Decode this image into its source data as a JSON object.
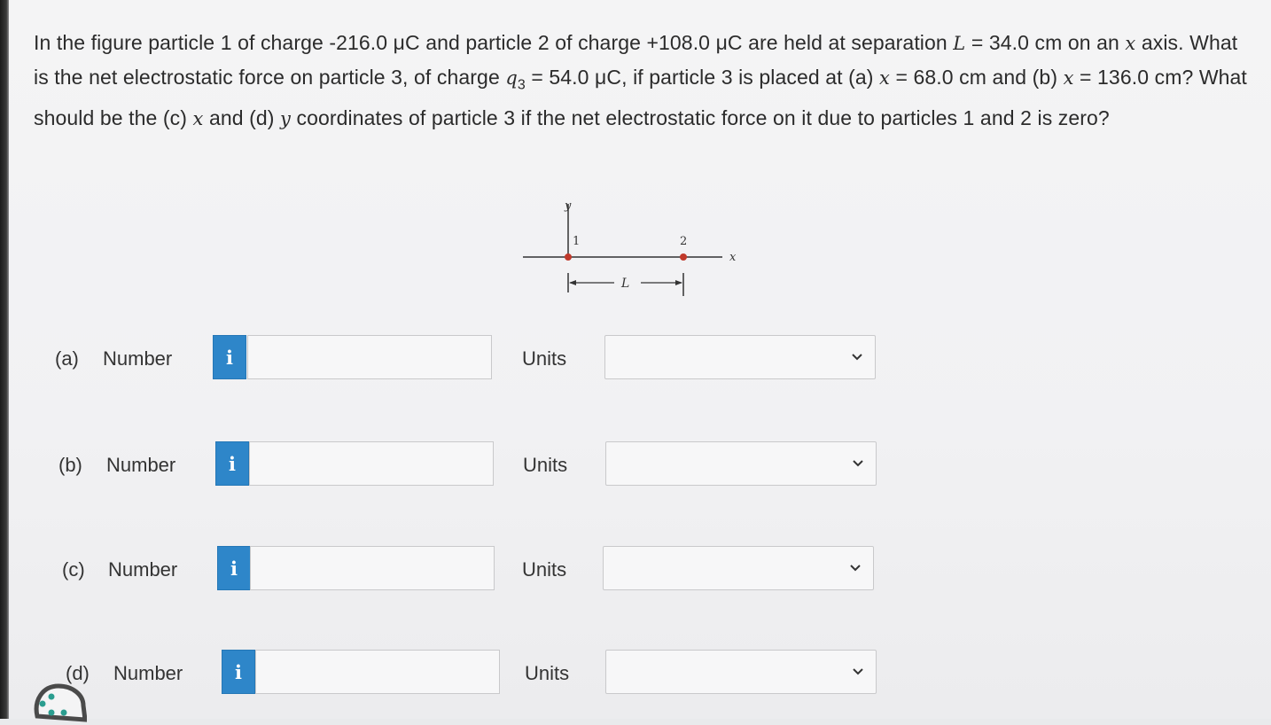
{
  "question": {
    "s1": "In the figure particle 1 of charge -216.0 μC and particle 2 of charge +108.0 μC are held at separation ",
    "L": "L",
    "s2": " = 34.0 cm on an ",
    "x1": "x",
    "s3": " axis. What is the net electrostatic force on particle 3, of charge ",
    "q3": "q",
    "q3sub": "3",
    "s4": " = 54.0 μC, if particle 3 is placed at (a) ",
    "x2": "x",
    "s5": " = 68.0 cm and (b) ",
    "x3": "x",
    "s6": " = 136.0 cm? What should be the (c) ",
    "x4": "x",
    "s7": " and (d) ",
    "y1": "y",
    "s8": " coordinates of particle 3 if the net electrostatic force on it due to particles 1 and 2 is zero?"
  },
  "figure": {
    "y_axis_label": "y",
    "x_axis_label": "x",
    "particle1_label": "1",
    "particle2_label": "2",
    "separation_label": "L",
    "particle1_color": "#c0392b",
    "particle2_color": "#c0392b"
  },
  "parts": [
    {
      "part": "(a)",
      "number_label": "Number",
      "info_icon": "i",
      "number_value": "",
      "units_label": "Units",
      "units_value": ""
    },
    {
      "part": "(b)",
      "number_label": "Number",
      "info_icon": "i",
      "number_value": "",
      "units_label": "Units",
      "units_value": ""
    },
    {
      "part": "(c)",
      "number_label": "Number",
      "info_icon": "i",
      "number_value": "",
      "units_label": "Units",
      "units_value": ""
    },
    {
      "part": "(d)",
      "number_label": "Number",
      "info_icon": "i",
      "number_value": "",
      "units_label": "Units",
      "units_value": ""
    }
  ],
  "colors": {
    "info_button": "#2e86c9",
    "text": "#2b2b2b"
  }
}
